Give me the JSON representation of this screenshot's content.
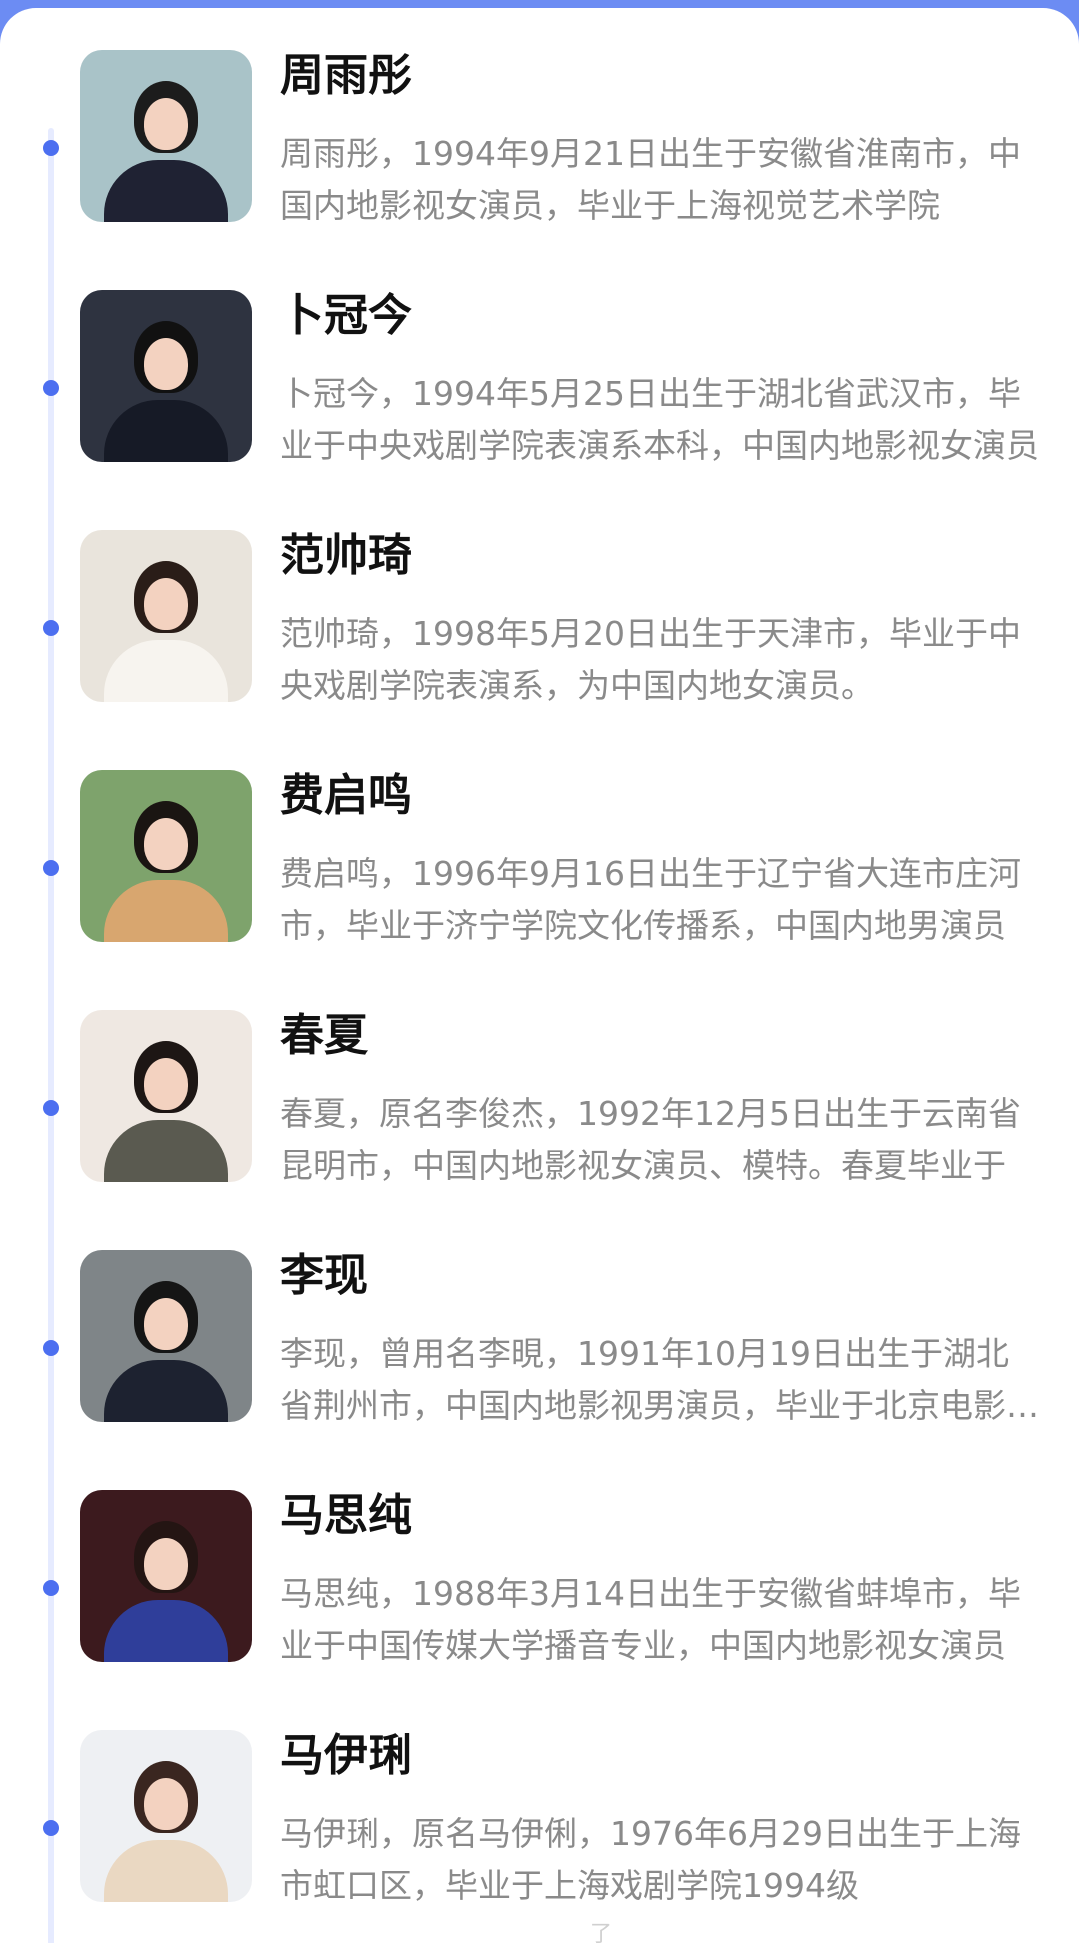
{
  "people": [
    {
      "name": "周雨彤",
      "desc": "周雨彤，1994年9月21日出生于安徽省淮南市，中国内地影视女演员，毕业于上海视觉艺术学院",
      "colors": {
        "bg": "#a9c3c8",
        "hair": "#1c1c1c",
        "body": "#1f2233"
      }
    },
    {
      "name": "卜冠今",
      "desc": "卜冠今，1994年5月25日出生于湖北省武汉市，毕业于中央戏剧学院表演系本科，中国内地影视女演员",
      "colors": {
        "bg": "#2e3340",
        "hair": "#111111",
        "body": "#161a26"
      }
    },
    {
      "name": "范帅琦",
      "desc": "范帅琦，1998年5月20日出生于天津市，毕业于中央戏剧学院表演系，为中国内地女演员。",
      "colors": {
        "bg": "#e9e4dc",
        "hair": "#2a1d18",
        "body": "#f7f4ef"
      }
    },
    {
      "name": "费启鸣",
      "desc": "费启鸣，1996年9月16日出生于辽宁省大连市庄河市，毕业于济宁学院文化传播系，中国内地男演员",
      "colors": {
        "bg": "#7ea36c",
        "hair": "#1a1512",
        "body": "#d8a66f"
      }
    },
    {
      "name": "春夏",
      "desc": "春夏，原名李俊杰，1992年12月5日出生于云南省昆明市，中国内地影视女演员、模特。春夏毕业于",
      "colors": {
        "bg": "#efe8e2",
        "hair": "#1d1614",
        "body": "#5a5a50"
      }
    },
    {
      "name": "李现",
      "desc": "李现，曾用名李晛，1991年10月19日出生于湖北省荆州市，中国内地影视男演员，毕业于北京电影学院",
      "colors": {
        "bg": "#7f8588",
        "hair": "#151515",
        "body": "#1d2230"
      }
    },
    {
      "name": "马思纯",
      "desc": "马思纯，1988年3月14日出生于安徽省蚌埠市，毕业于中国传媒大学播音专业，中国内地影视女演员",
      "colors": {
        "bg": "#3c1a1e",
        "hair": "#241513",
        "body": "#2f3e9a"
      }
    },
    {
      "name": "马伊琍",
      "desc": "马伊琍，原名马伊俐，1976年6月29日出生于上海市虹口区，毕业于上海戏剧学院1994级",
      "colors": {
        "bg": "#eef0f3",
        "hair": "#3a2620",
        "body": "#ead8c2"
      }
    }
  ],
  "watermark": "了"
}
